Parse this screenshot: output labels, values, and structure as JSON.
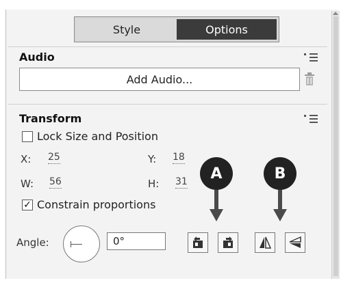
{
  "tabs": [
    {
      "label": "Style",
      "active": false
    },
    {
      "label": "Options",
      "active": true
    }
  ],
  "audio": {
    "title": "Audio",
    "add_button_label": "Add Audio...",
    "menu_icon": "panel-menu-icon",
    "delete_icon": "trash-icon"
  },
  "transform": {
    "title": "Transform",
    "lock_label": "Lock Size and Position",
    "lock_checked": false,
    "x_label": "X:",
    "x_value": "25",
    "y_label": "Y:",
    "y_value": "18",
    "w_label": "W:",
    "w_value": "56",
    "h_label": "H:",
    "h_value": "31",
    "constrain_label": "Constrain proportions",
    "constrain_checked": true,
    "angle_label": "Angle:",
    "angle_value": "0°",
    "tool_buttons": [
      "rotate-left-icon",
      "rotate-right-icon",
      "flip-horizontal-icon",
      "flip-vertical-icon"
    ]
  },
  "callouts": [
    {
      "letter": "A"
    },
    {
      "letter": "B"
    }
  ],
  "colors": {
    "active_tab": "#3b3b3b",
    "panel_bg": "#f3f3f3",
    "callout": "#222222"
  }
}
